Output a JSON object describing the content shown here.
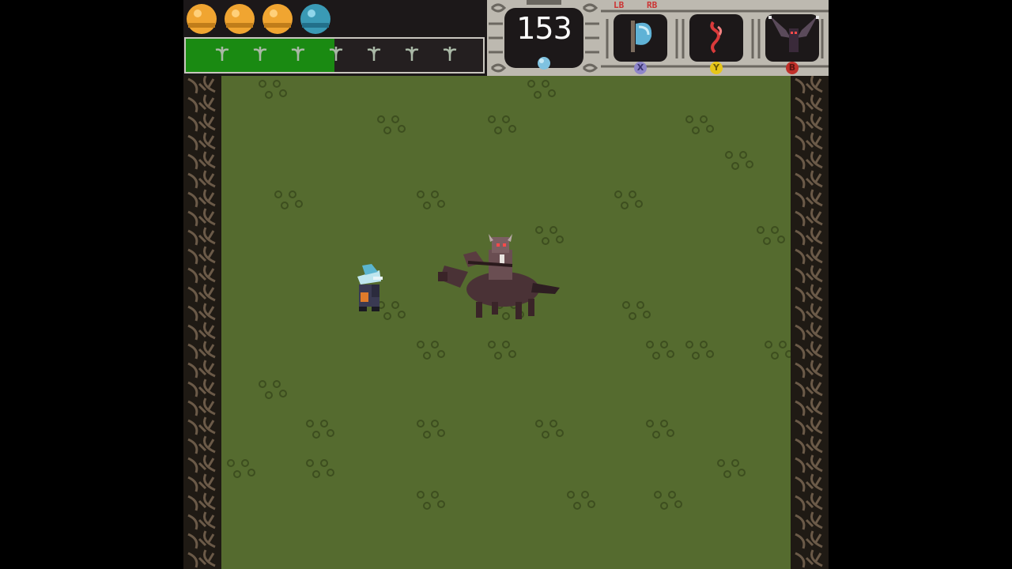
{
  "hud": {
    "health_orbs": [
      {
        "type": "gold"
      },
      {
        "type": "gold"
      },
      {
        "type": "gold"
      },
      {
        "type": "blue"
      }
    ],
    "stamina_fraction": 0.5,
    "stamina_markers": 7,
    "currency": {
      "value": "153",
      "icon": "blue-gem-icon"
    },
    "shoulder_labels": {
      "left": "LB",
      "right": "RB"
    },
    "slots": [
      {
        "name": "axe-icon",
        "button": "X",
        "button_color": "#8e86c9"
      },
      {
        "name": "flame-icon",
        "button": "Y",
        "button_color": "#e6c619"
      },
      {
        "name": "bat-familiar-icon",
        "button": "B",
        "button_color": "#c0302a"
      }
    ]
  },
  "colors": {
    "grass": "#556b2f",
    "grass_detail": "#3d4e1f",
    "hud_bg": "#1c1819",
    "frame": "#bdb9b0",
    "stamina": "#1a8a12"
  },
  "entities": {
    "player": "knight-player-sprite",
    "enemy": "horseman-enemy-sprite"
  }
}
